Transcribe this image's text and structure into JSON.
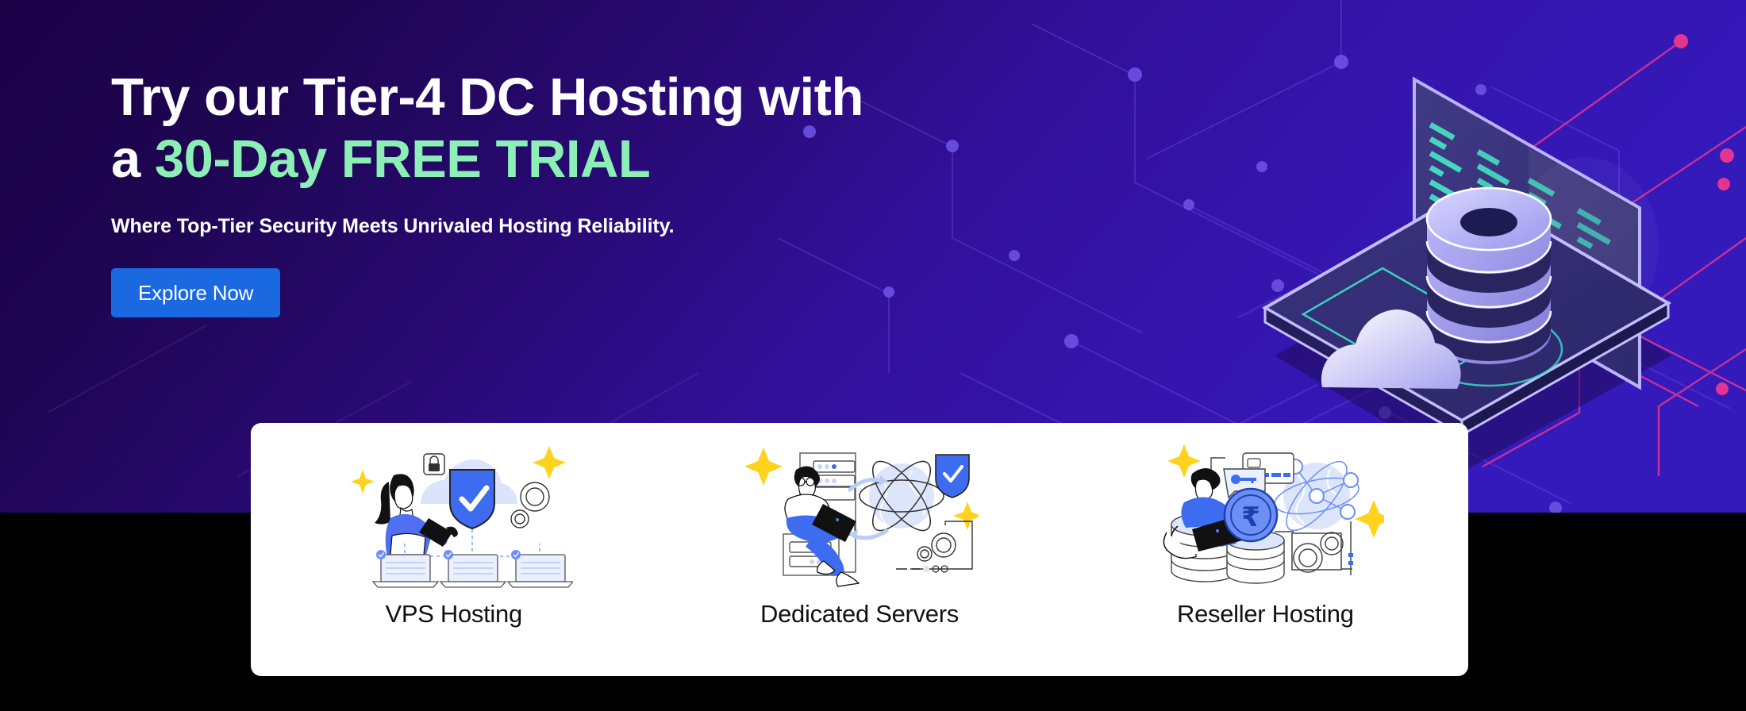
{
  "hero": {
    "headline_line1": "Try our Tier-4 DC Hosting with",
    "headline_line2_prefix": "a ",
    "headline_line2_accent": "30-Day FREE TRIAL",
    "subhead": "Where Top-Tier Security Meets Unrivaled Hosting Reliability.",
    "cta_label": "Explore Now",
    "colors": {
      "bg_left": "#1b0247",
      "bg_right": "#3419bb",
      "accent_green": "#8cf0b6",
      "cta_blue": "#1b69e0",
      "circuit_purple": "#6a49d6",
      "circuit_pink": "#e0368f",
      "teal": "#3ee0c8"
    }
  },
  "cards": [
    {
      "label": "VPS Hosting",
      "icon": "vps-hosting-illustration"
    },
    {
      "label": "Dedicated Servers",
      "icon": "dedicated-servers-illustration"
    },
    {
      "label": "Reseller Hosting",
      "icon": "reseller-hosting-illustration"
    }
  ],
  "illustration": {
    "name": "isometric-laptop-database-cloud",
    "elements": [
      "laptop",
      "code-screen",
      "database-cylinder",
      "cloud",
      "circuit-board"
    ]
  },
  "footer": {
    "bar_color": "#000000"
  }
}
